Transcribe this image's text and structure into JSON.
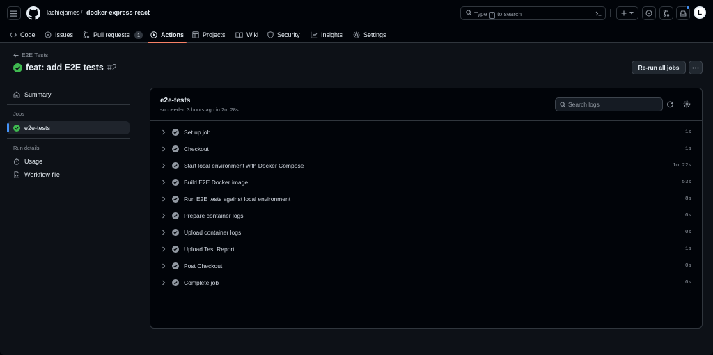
{
  "header": {
    "owner": "lachiejames",
    "separator": "/",
    "repo": "docker-express-react",
    "search": {
      "prefix": "Type",
      "key": "/",
      "suffix": "to search"
    },
    "avatar_letter": "L"
  },
  "tabs": [
    {
      "label": "Code",
      "icon": "code-icon"
    },
    {
      "label": "Issues",
      "icon": "issue-icon"
    },
    {
      "label": "Pull requests",
      "icon": "pull-request-icon",
      "count": "1"
    },
    {
      "label": "Actions",
      "icon": "play-icon",
      "active": true
    },
    {
      "label": "Projects",
      "icon": "table-icon"
    },
    {
      "label": "Wiki",
      "icon": "book-icon"
    },
    {
      "label": "Security",
      "icon": "shield-icon"
    },
    {
      "label": "Insights",
      "icon": "graph-icon"
    },
    {
      "label": "Settings",
      "icon": "gear-icon"
    }
  ],
  "run": {
    "back_label": "E2E Tests",
    "title": "feat: add E2E tests",
    "number": "#2",
    "rerun_label": "Re-run all jobs"
  },
  "sidebar": {
    "summary_label": "Summary",
    "jobs_heading": "Jobs",
    "job_label": "e2e-tests",
    "run_details_heading": "Run details",
    "usage_label": "Usage",
    "workflow_file_label": "Workflow file"
  },
  "job": {
    "title": "e2e-tests",
    "subtitle": "succeeded 3 hours ago in 2m 28s",
    "search_placeholder": "Search logs",
    "steps": [
      {
        "name": "Set up job",
        "duration": "1s"
      },
      {
        "name": "Checkout",
        "duration": "1s"
      },
      {
        "name": "Start local environment with Docker Compose",
        "duration": "1m 22s"
      },
      {
        "name": "Build E2E Docker image",
        "duration": "53s"
      },
      {
        "name": "Run E2E tests against local environment",
        "duration": "8s"
      },
      {
        "name": "Prepare container logs",
        "duration": "0s"
      },
      {
        "name": "Upload container logs",
        "duration": "0s"
      },
      {
        "name": "Upload Test Report",
        "duration": "1s"
      },
      {
        "name": "Post Checkout",
        "duration": "0s"
      },
      {
        "name": "Complete job",
        "duration": "0s"
      }
    ]
  },
  "colors": {
    "success": "#3fb950",
    "accent_tab": "#f78166",
    "selected_bar": "#4493f8"
  }
}
